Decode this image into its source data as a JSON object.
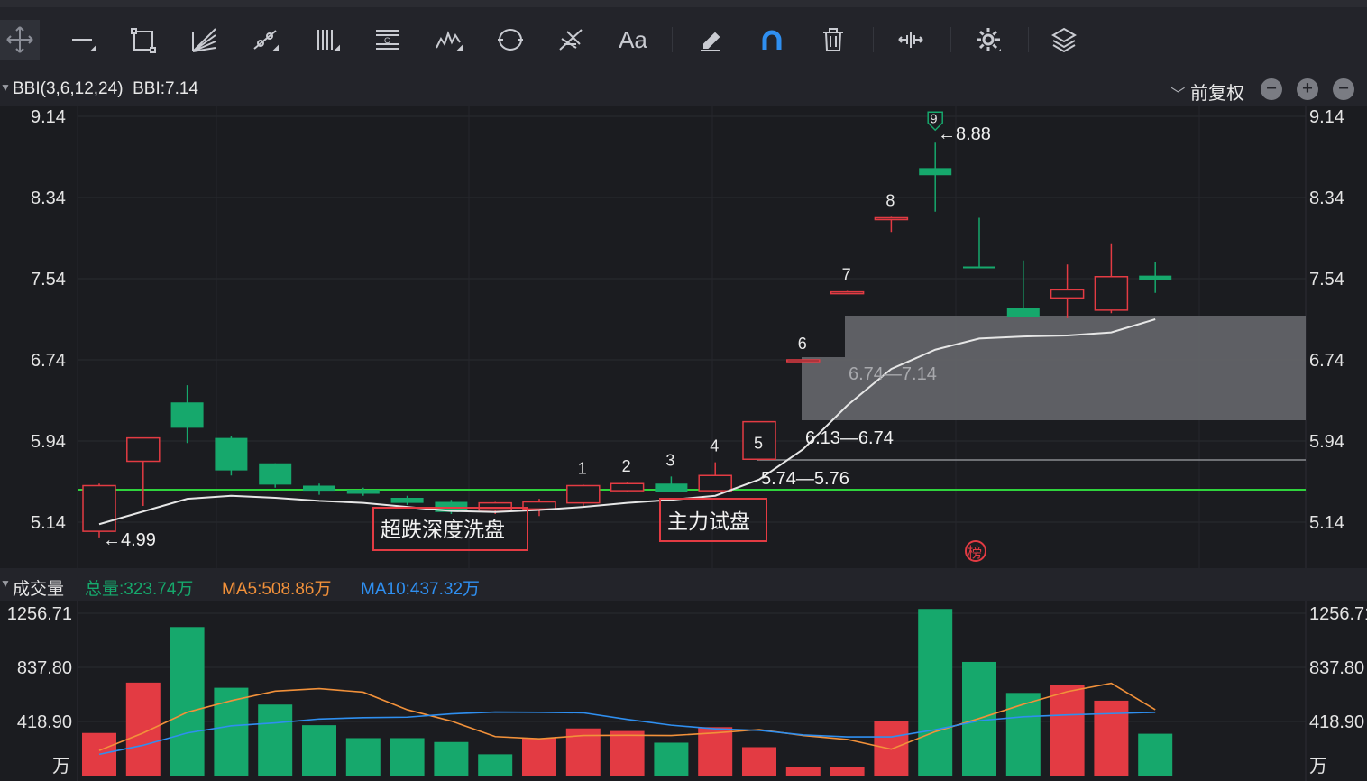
{
  "toolbar": {
    "icons": [
      "move-cross-icon",
      "horizontal-line-icon",
      "rectangle-icon",
      "fan-lines-icon",
      "trend-tool-icon",
      "parallel-lines-icon",
      "gann-icon",
      "wave-icon",
      "cycle-icon",
      "pitchfork-icon",
      "text-icon",
      "eraser-icon",
      "magnet-icon",
      "trash-icon",
      "zoom-fit-icon",
      "settings-gear-icon",
      "layers-icon"
    ],
    "text_tool": "Aa"
  },
  "indicator_bar": {
    "name": "BBI(3,6,12,24)",
    "value": "BBI:7.14",
    "adjust": "前复权",
    "buttons": [
      "minus",
      "plus",
      "minus"
    ]
  },
  "price_axis": {
    "ticks": [
      "9.14",
      "8.34",
      "7.54",
      "6.74",
      "5.94",
      "5.14"
    ]
  },
  "annotations": {
    "high_marker": "←8.88",
    "low_marker": "←4.99",
    "zone_upper": "6.74—7.14",
    "zone_lower": "6.13—6.74",
    "line_label": "5.74—5.76",
    "box1": "超跌深度洗盘",
    "box2": "主力试盘",
    "counts": [
      "1",
      "2",
      "3",
      "4",
      "5",
      "6",
      "7",
      "8",
      "9"
    ],
    "bang": "榜"
  },
  "volume_bar": {
    "title": "成交量",
    "total": "总量:323.74万",
    "ma5": "MA5:508.86万",
    "ma10": "MA10:437.32万"
  },
  "volume_axis": {
    "ticks": [
      "1256.71",
      "837.80",
      "418.90"
    ],
    "unit": "万"
  },
  "colors": {
    "up": "#e33b43",
    "down": "#16a86c",
    "bbi": "#e6e6e6",
    "support_line": "#2fd33d",
    "ma5": "#f2913a",
    "ma10": "#2f8ff0",
    "zone": "#6c6c70"
  },
  "chart_data": {
    "type": "candlestick",
    "candles": [
      {
        "o": 5.5,
        "h": 5.52,
        "l": 4.99,
        "c": 5.05,
        "dir": "up"
      },
      {
        "o": 5.74,
        "h": 5.92,
        "l": 5.3,
        "c": 5.97,
        "dir": "up"
      },
      {
        "o": 6.32,
        "h": 6.49,
        "l": 5.92,
        "c": 6.07,
        "dir": "down"
      },
      {
        "o": 5.97,
        "h": 5.99,
        "l": 5.6,
        "c": 5.65,
        "dir": "down"
      },
      {
        "o": 5.72,
        "h": 5.72,
        "l": 5.48,
        "c": 5.51,
        "dir": "down"
      },
      {
        "o": 5.5,
        "h": 5.52,
        "l": 5.41,
        "c": 5.45,
        "dir": "down"
      },
      {
        "o": 5.46,
        "h": 5.48,
        "l": 5.4,
        "c": 5.42,
        "dir": "down"
      },
      {
        "o": 5.38,
        "h": 5.4,
        "l": 5.31,
        "c": 5.33,
        "dir": "down"
      },
      {
        "o": 5.34,
        "h": 5.36,
        "l": 5.22,
        "c": 5.24,
        "dir": "down"
      },
      {
        "o": 5.26,
        "h": 5.34,
        "l": 5.22,
        "c": 5.33,
        "dir": "up"
      },
      {
        "o": 5.27,
        "h": 5.37,
        "l": 5.2,
        "c": 5.34,
        "dir": "up"
      },
      {
        "o": 5.33,
        "h": 5.51,
        "l": 5.3,
        "c": 5.5,
        "dir": "up"
      },
      {
        "o": 5.45,
        "h": 5.53,
        "l": 5.44,
        "c": 5.52,
        "dir": "up"
      },
      {
        "o": 5.52,
        "h": 5.59,
        "l": 5.44,
        "c": 5.44,
        "dir": "down"
      },
      {
        "o": 5.45,
        "h": 5.73,
        "l": 5.44,
        "c": 5.6,
        "dir": "up"
      },
      {
        "o": 5.76,
        "h": 5.76,
        "l": 5.75,
        "c": 6.13,
        "dir": "up"
      },
      {
        "o": 6.74,
        "h": 6.74,
        "l": 6.73,
        "c": 6.74,
        "dir": "up"
      },
      {
        "o": 7.41,
        "h": 7.42,
        "l": 7.4,
        "c": 7.41,
        "dir": "up"
      },
      {
        "o": 8.14,
        "h": 8.15,
        "l": 8.0,
        "c": 8.14,
        "dir": "up"
      },
      {
        "o": 8.63,
        "h": 8.88,
        "l": 8.2,
        "c": 8.56,
        "dir": "down"
      },
      {
        "o": 7.66,
        "h": 8.14,
        "l": 7.66,
        "c": 7.66,
        "dir": "down"
      },
      {
        "o": 7.25,
        "h": 7.72,
        "l": 7.18,
        "c": 7.16,
        "dir": "down"
      },
      {
        "o": 7.35,
        "h": 7.68,
        "l": 7.15,
        "c": 7.43,
        "dir": "up"
      },
      {
        "o": 7.23,
        "h": 7.88,
        "l": 7.2,
        "c": 7.56,
        "dir": "up"
      },
      {
        "o": 7.57,
        "h": 7.7,
        "l": 7.4,
        "c": 7.53,
        "dir": "down"
      }
    ],
    "bbi": [
      5.12,
      null,
      5.37,
      5.4,
      5.38,
      5.35,
      5.33,
      5.29,
      5.25,
      5.24,
      5.26,
      5.29,
      5.33,
      5.36,
      5.4,
      5.56,
      5.86,
      6.29,
      6.65,
      6.84,
      6.95,
      6.97,
      6.98,
      7.01,
      7.14
    ],
    "volume": [
      {
        "v": 330,
        "dir": "up"
      },
      {
        "v": 720,
        "dir": "up"
      },
      {
        "v": 1150,
        "dir": "down"
      },
      {
        "v": 680,
        "dir": "down"
      },
      {
        "v": 550,
        "dir": "down"
      },
      {
        "v": 390,
        "dir": "down"
      },
      {
        "v": 290,
        "dir": "down"
      },
      {
        "v": 290,
        "dir": "down"
      },
      {
        "v": 260,
        "dir": "down"
      },
      {
        "v": 165,
        "dir": "down"
      },
      {
        "v": 290,
        "dir": "up"
      },
      {
        "v": 365,
        "dir": "up"
      },
      {
        "v": 345,
        "dir": "up"
      },
      {
        "v": 255,
        "dir": "down"
      },
      {
        "v": 375,
        "dir": "up"
      },
      {
        "v": 220,
        "dir": "up"
      },
      {
        "v": 65,
        "dir": "up"
      },
      {
        "v": 65,
        "dir": "up"
      },
      {
        "v": 420,
        "dir": "up"
      },
      {
        "v": 1290,
        "dir": "down"
      },
      {
        "v": 880,
        "dir": "down"
      },
      {
        "v": 640,
        "dir": "down"
      },
      {
        "v": 700,
        "dir": "up"
      },
      {
        "v": 580,
        "dir": "up"
      },
      {
        "v": 324,
        "dir": "down"
      }
    ],
    "ma5": [
      195,
      330,
      490,
      580,
      654,
      673,
      646,
      510,
      422,
      302,
      285,
      310,
      312,
      310,
      330,
      356,
      310,
      280,
      205,
      340,
      442,
      552,
      650,
      715,
      510
    ],
    "ma10": [
      165,
      235,
      330,
      385,
      408,
      438,
      448,
      452,
      478,
      492,
      490,
      486,
      435,
      390,
      362,
      350,
      315,
      300,
      300,
      355,
      425,
      455,
      470,
      480,
      490
    ],
    "price_axis_range": [
      5.14,
      9.14
    ],
    "volume_axis_range": [
      0,
      1256.71
    ]
  }
}
